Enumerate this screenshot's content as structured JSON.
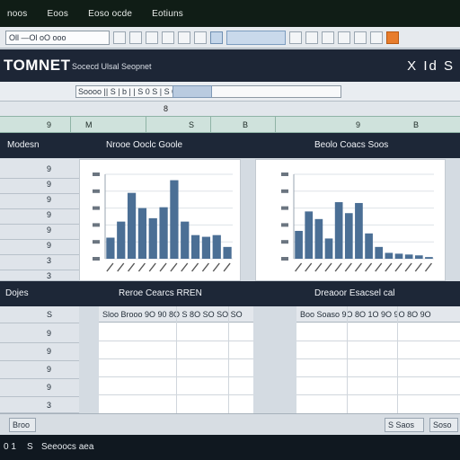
{
  "menubar": {
    "items": [
      "noos",
      "Eoos",
      "Eoso ocde",
      "Eotiuns"
    ]
  },
  "toolbar": {
    "address": "Oll —Ol oO ooo"
  },
  "app": {
    "title": "TOMNET",
    "subtitle": "Socecd Ulsal Seopnet",
    "window_controls": "X Id S"
  },
  "formula": {
    "value": "Soooo  ||   S |   b |              |   S 0 S |   S 0 S |  S 0 S"
  },
  "ruler": {
    "marker": "8"
  },
  "column_header": {
    "labels": [
      "9",
      "M",
      "S",
      "B",
      "9",
      "B"
    ]
  },
  "section1": {
    "left": "Modesn",
    "center": "Nrooe Ooclc Goole",
    "right": "Beolo Coacs Soos"
  },
  "section2": {
    "left": "Dojes",
    "center": "Reroe Cearcs RREN",
    "right": "Dreaoor Esacsel cal"
  },
  "rows_top": [
    "9",
    "9",
    "9",
    "9",
    "9",
    "9",
    "3",
    "3"
  ],
  "rows_bottom": [
    "S",
    "9",
    "9",
    "9",
    "9",
    "3"
  ],
  "table_left": {
    "header": "Sloo Brooo  9O  90  8O  S 8O  SO  SO  SO"
  },
  "table_right": {
    "header": "Boo Soaso  9O  8O  1O  9O  9O  8O  9O"
  },
  "status": {
    "left": "Broo",
    "right_a": "S Saos",
    "right_b": "Soso"
  },
  "taskbar": {
    "icons": "0  1",
    "label_s": "S",
    "label_text": "Seeoocs aea"
  },
  "chart_data": [
    {
      "type": "bar",
      "categories": [
        "",
        "",
        "",
        "",
        "",
        "",
        "",
        "",
        "",
        "",
        "",
        ""
      ],
      "values": [
        2.5,
        4.4,
        7.8,
        6.0,
        4.8,
        6.1,
        9.3,
        4.4,
        2.8,
        2.6,
        2.8,
        1.4
      ],
      "color": "#4b6f95"
    },
    {
      "type": "bar",
      "categories": [
        "",
        "",
        "",
        "",
        "",
        "",
        "",
        "",
        "",
        "",
        "",
        "",
        "",
        ""
      ],
      "values": [
        3.3,
        5.6,
        4.7,
        2.4,
        6.7,
        5.4,
        6.6,
        3.0,
        1.4,
        0.7,
        0.6,
        0.5,
        0.4,
        0.2
      ],
      "color": "#4b6f95"
    }
  ]
}
